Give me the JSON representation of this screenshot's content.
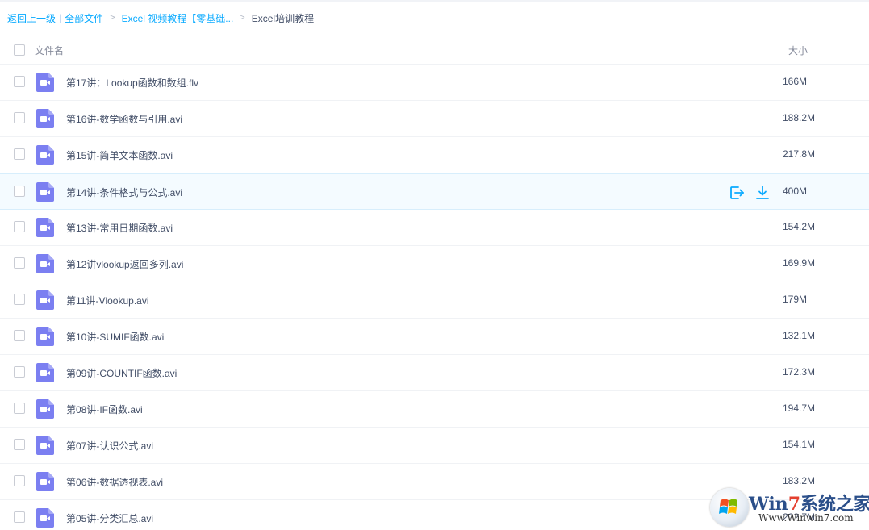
{
  "breadcrumb": {
    "back": "返回上一级",
    "separator": "|",
    "all_files": "全部文件",
    "folder1": "Excel 视频教程【零基础...",
    "folder2": "Excel培训教程",
    "chevron": ">"
  },
  "header": {
    "name_label": "文件名",
    "size_label": "大小"
  },
  "files": [
    {
      "name": "第17讲：Lookup函数和数组.flv",
      "size": "166M"
    },
    {
      "name": "第16讲-数学函数与引用.avi",
      "size": "188.2M"
    },
    {
      "name": "第15讲-简单文本函数.avi",
      "size": "217.8M"
    },
    {
      "name": "第14讲-条件格式与公式.avi",
      "size": "400M"
    },
    {
      "name": "第13讲-常用日期函数.avi",
      "size": "154.2M"
    },
    {
      "name": "第12讲vlookup返回多列.avi",
      "size": "169.9M"
    },
    {
      "name": "第11讲-Vlookup.avi",
      "size": "179M"
    },
    {
      "name": "第10讲-SUMIF函数.avi",
      "size": "132.1M"
    },
    {
      "name": "第09讲-COUNTIF函数.avi",
      "size": "172.3M"
    },
    {
      "name": "第08讲-IF函数.avi",
      "size": "194.7M"
    },
    {
      "name": "第07讲-认识公式.avi",
      "size": "154.1M"
    },
    {
      "name": "第06讲-数据透视表.avi",
      "size": "183.2M"
    },
    {
      "name": "第05讲-分类汇总.avi",
      "size": "2??.7M"
    }
  ],
  "icons": {
    "file_type": "video-file-icon",
    "share": "share-icon",
    "download": "download-icon",
    "file_color": "#7b7ff1",
    "action_color": "#09aaff"
  },
  "watermark": {
    "brand_prefix": "Win",
    "brand_digit": "7",
    "brand_suffix": "系统之家",
    "url": "Www.Winwin7.com"
  }
}
